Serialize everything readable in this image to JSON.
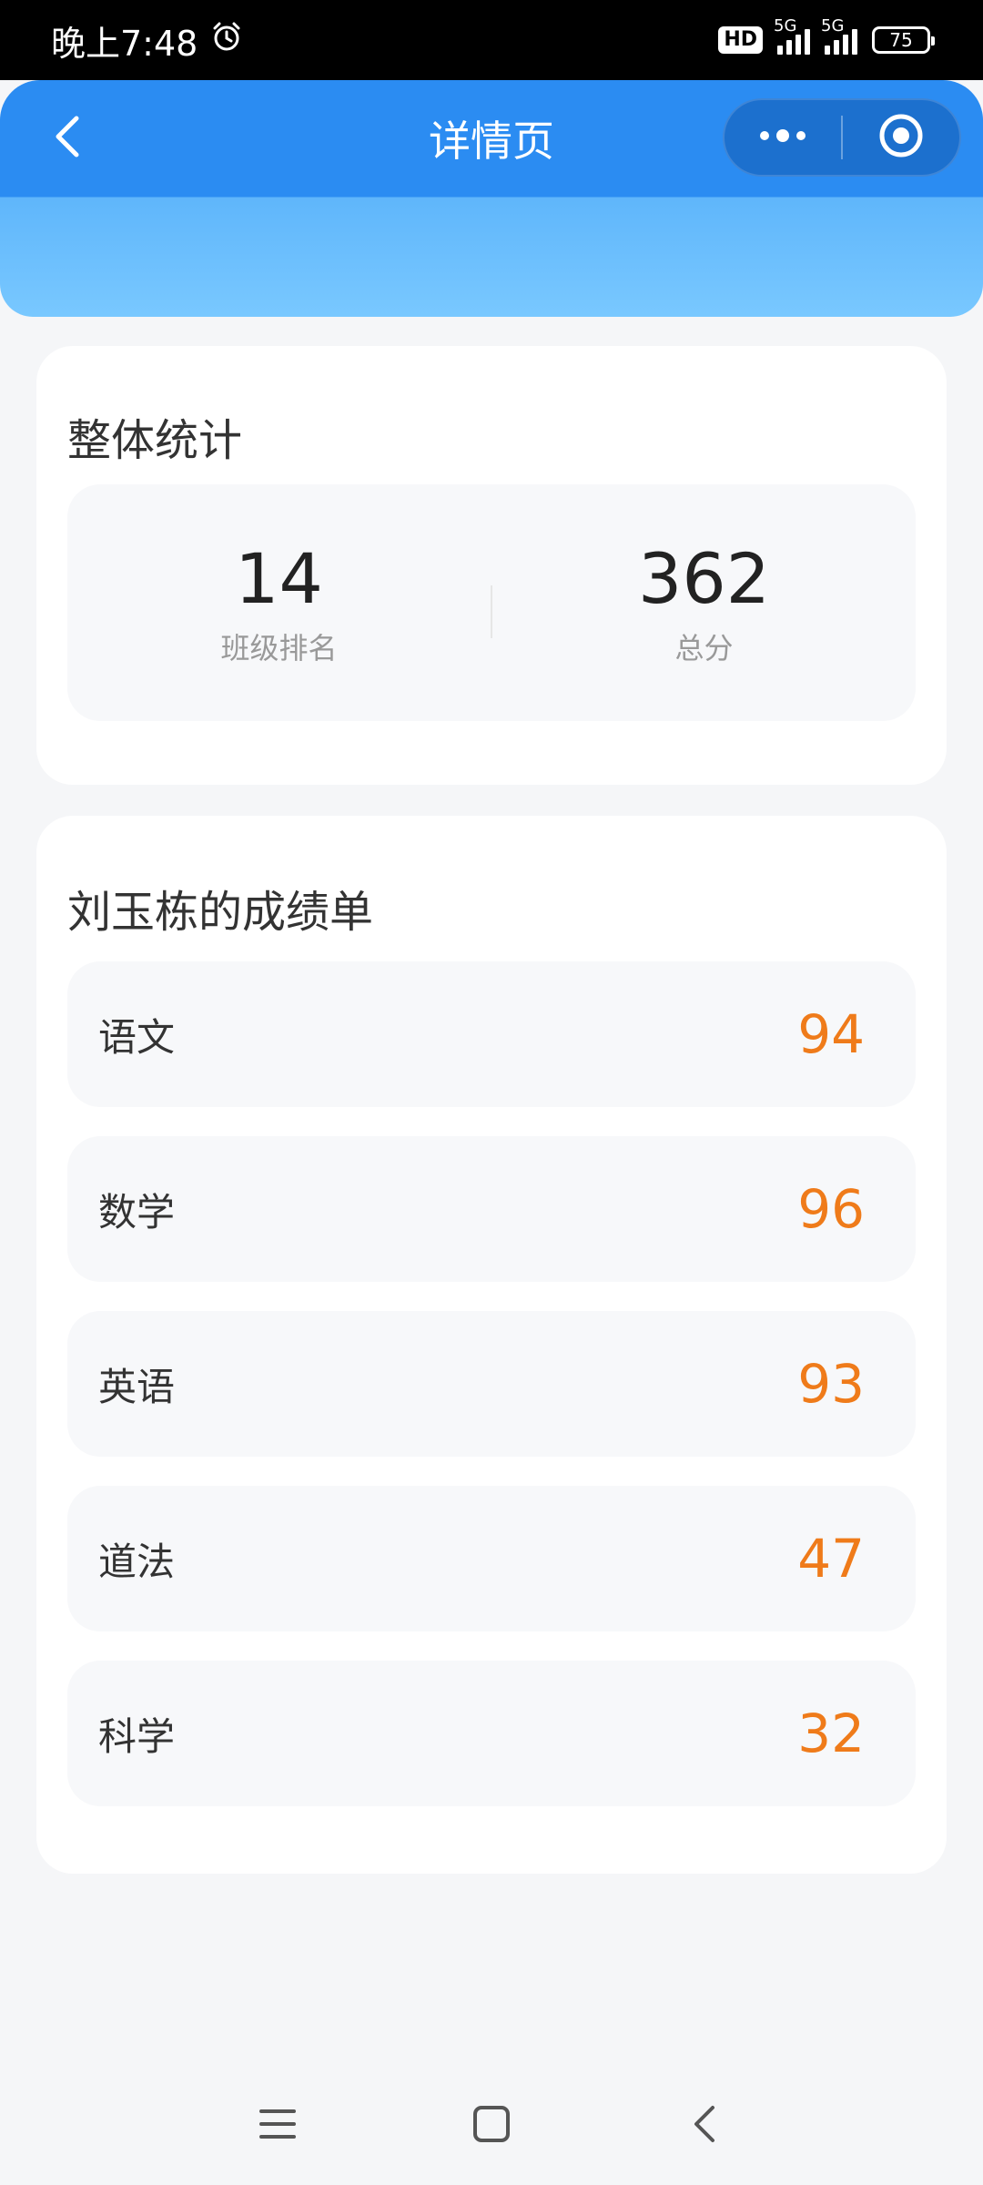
{
  "status_bar": {
    "time": "晚上7:48",
    "hd_label": "HD",
    "network_1": "5G",
    "network_2": "5G",
    "battery": "75"
  },
  "header": {
    "title": "详情页"
  },
  "overall": {
    "title": "整体统计",
    "stats": [
      {
        "value": "14",
        "label": "班级排名"
      },
      {
        "value": "362",
        "label": "总分"
      }
    ]
  },
  "report": {
    "title": "刘玉栋的成绩单",
    "subjects": [
      {
        "name": "语文",
        "score": "94"
      },
      {
        "name": "数学",
        "score": "96"
      },
      {
        "name": "英语",
        "score": "93"
      },
      {
        "name": "道法",
        "score": "47"
      },
      {
        "name": "科学",
        "score": "32"
      }
    ]
  },
  "colors": {
    "header_blue": "#2b8cf2",
    "score_orange": "#ef7b1a",
    "background": "#f5f6f8"
  },
  "icons": {
    "back": "chevron-left-icon",
    "more": "more-dots-icon",
    "close": "target-circle-icon",
    "alarm": "alarm-icon",
    "nav_menu": "menu-icon",
    "nav_home": "square-home-icon",
    "nav_back": "chevron-back-icon"
  }
}
